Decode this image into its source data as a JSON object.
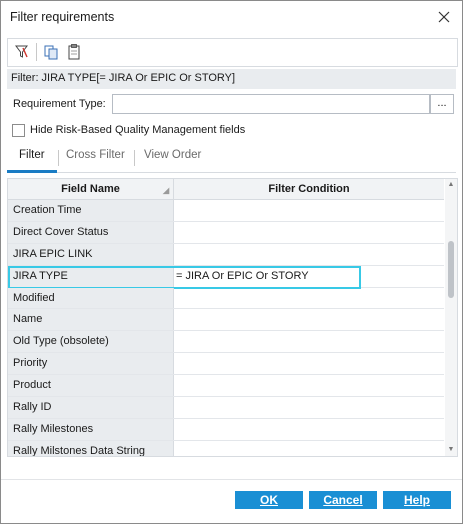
{
  "window": {
    "title": "Filter requirements"
  },
  "toolbar": {
    "icons": [
      "filter-clear-icon",
      "copy-icon",
      "paste-icon"
    ]
  },
  "filter_summary": "Filter: JIRA TYPE[= JIRA Or EPIC Or STORY]",
  "requirement_type": {
    "label": "Requirement Type:",
    "value": "",
    "browse_label": "..."
  },
  "checkbox": {
    "label": "Hide Risk-Based Quality Management fields",
    "checked": false
  },
  "tabs": [
    {
      "label": "Filter",
      "active": true
    },
    {
      "label": "Cross Filter",
      "active": false
    },
    {
      "label": "View Order",
      "active": false
    }
  ],
  "grid": {
    "headers": {
      "field": "Field Name",
      "condition": "Filter Condition"
    },
    "rows": [
      {
        "field": "Creation Time",
        "condition": ""
      },
      {
        "field": "Direct Cover Status",
        "condition": ""
      },
      {
        "field": "JIRA EPIC LINK",
        "condition": ""
      },
      {
        "field": "JIRA TYPE",
        "condition": "= JIRA Or EPIC  Or STORY",
        "highlighted": true
      },
      {
        "field": "Modified",
        "condition": ""
      },
      {
        "field": "Name",
        "condition": ""
      },
      {
        "field": "Old Type (obsolete)",
        "condition": ""
      },
      {
        "field": "Priority",
        "condition": ""
      },
      {
        "field": "Product",
        "condition": ""
      },
      {
        "field": "Rally ID",
        "condition": ""
      },
      {
        "field": "Rally Milestones",
        "condition": ""
      },
      {
        "field": "Rally Milstones Data String",
        "condition": ""
      }
    ]
  },
  "buttons": {
    "ok": "OK",
    "cancel": "Cancel",
    "help": "Help"
  },
  "colors": {
    "accent": "#1a8fd4",
    "highlight": "#38c9e6",
    "tab_underline": "#1a7cc4"
  }
}
